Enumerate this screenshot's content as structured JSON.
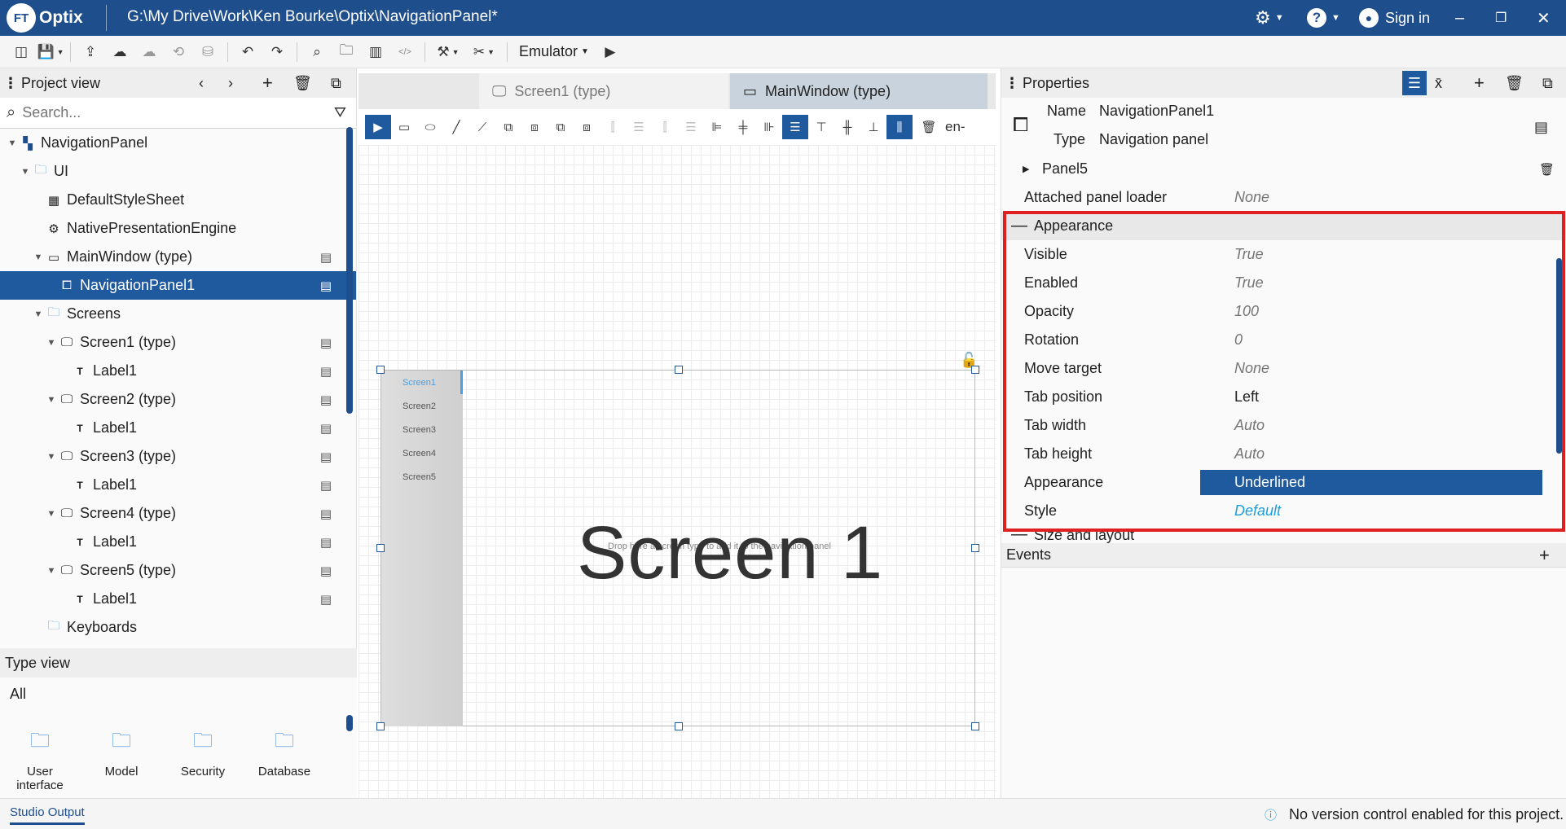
{
  "app": {
    "logo_short": "FT",
    "logo_name": "Optix",
    "window_path": "G:\\My Drive\\Work\\Ken Bourke\\Optix\\NavigationPanel*",
    "sign_in": "Sign in"
  },
  "toolbar": {
    "emulator_label": "Emulator"
  },
  "project_view": {
    "title": "Project view",
    "search_placeholder": "Search...",
    "tree": [
      {
        "label": "NavigationPanel",
        "level": 0,
        "icon": "project-icon",
        "expand": "open"
      },
      {
        "label": "UI",
        "level": 1,
        "icon": "folder-icon",
        "expand": "open"
      },
      {
        "label": "DefaultStyleSheet",
        "level": 2,
        "icon": "stylesheet-icon",
        "expand": ""
      },
      {
        "label": "NativePresentationEngine",
        "level": 2,
        "icon": "gear-icon",
        "expand": ""
      },
      {
        "label": "MainWindow (type)",
        "level": 2,
        "icon": "window-icon",
        "expand": "open",
        "action": true
      },
      {
        "label": "NavigationPanel1",
        "level": 3,
        "icon": "navigation-panel-icon",
        "expand": "",
        "action": true,
        "selected": true
      },
      {
        "label": "Screens",
        "level": 2,
        "icon": "folder-icon",
        "expand": "open"
      },
      {
        "label": "Screen1 (type)",
        "level": 3,
        "icon": "screen-icon",
        "expand": "open",
        "action": true
      },
      {
        "label": "Label1",
        "level": 4,
        "icon": "label-icon",
        "expand": "",
        "action": true
      },
      {
        "label": "Screen2 (type)",
        "level": 3,
        "icon": "screen-icon",
        "expand": "open",
        "action": true
      },
      {
        "label": "Label1",
        "level": 4,
        "icon": "label-icon",
        "expand": "",
        "action": true
      },
      {
        "label": "Screen3 (type)",
        "level": 3,
        "icon": "screen-icon",
        "expand": "open",
        "action": true
      },
      {
        "label": "Label1",
        "level": 4,
        "icon": "label-icon",
        "expand": "",
        "action": true
      },
      {
        "label": "Screen4 (type)",
        "level": 3,
        "icon": "screen-icon",
        "expand": "open",
        "action": true
      },
      {
        "label": "Label1",
        "level": 4,
        "icon": "label-icon",
        "expand": "",
        "action": true
      },
      {
        "label": "Screen5 (type)",
        "level": 3,
        "icon": "screen-icon",
        "expand": "open",
        "action": true
      },
      {
        "label": "Label1",
        "level": 4,
        "icon": "label-icon",
        "expand": "",
        "action": true
      },
      {
        "label": "Keyboards",
        "level": 2,
        "icon": "folder-icon",
        "expand": ""
      }
    ]
  },
  "type_view": {
    "title": "Type view",
    "filter": "All",
    "items": [
      {
        "line1": "User",
        "line2": "interface",
        "icon": "user-interface-icon"
      },
      {
        "line1": "Model",
        "line2": "",
        "icon": "model-icon"
      },
      {
        "line1": "Security",
        "line2": "",
        "icon": "security-icon"
      },
      {
        "line1": "Database",
        "line2": "",
        "icon": "database-icon"
      }
    ]
  },
  "editor": {
    "tabs": [
      {
        "label": "Screen1 (type)",
        "active": false
      },
      {
        "label": "MainWindow (type)",
        "active": true
      }
    ],
    "locale": "en-",
    "nav_tabs": [
      "Screen1",
      "Screen2",
      "Screen3",
      "Screen4",
      "Screen5"
    ],
    "screen_title": "Screen 1",
    "drop_hint": "Drop here a screen type to add it to the navigation panel"
  },
  "properties": {
    "title": "Properties",
    "name_label": "Name",
    "name_value": "NavigationPanel1",
    "type_label": "Type",
    "type_value": "Navigation panel",
    "panel5": "Panel5",
    "attached_label": "Attached panel loader",
    "attached_value": "None",
    "appearance_section": "Appearance",
    "rows": [
      {
        "name": "Visible",
        "value": "True",
        "style": "muted"
      },
      {
        "name": "Enabled",
        "value": "True",
        "style": "muted"
      },
      {
        "name": "Opacity",
        "value": "100",
        "style": "muted"
      },
      {
        "name": "Rotation",
        "value": "0",
        "style": "muted"
      },
      {
        "name": "Move target",
        "value": "None",
        "style": "muted"
      },
      {
        "name": "Tab position",
        "value": "Left",
        "style": "plain"
      },
      {
        "name": "Tab width",
        "value": "Auto",
        "style": "muted"
      },
      {
        "name": "Tab height",
        "value": "Auto",
        "style": "muted"
      },
      {
        "name": "Appearance",
        "value": "Underlined",
        "style": "selected"
      },
      {
        "name": "Style",
        "value": "Default",
        "style": "link"
      }
    ],
    "size_section": "Size and layout",
    "events": "Events"
  },
  "status": {
    "output_tab": "Studio Output",
    "message": "No version control enabled for this project."
  },
  "colors": {
    "brand": "#1f4e8c",
    "selection": "#1f5a9e",
    "highlight_box": "#e02020",
    "link": "#1e9ed8"
  }
}
